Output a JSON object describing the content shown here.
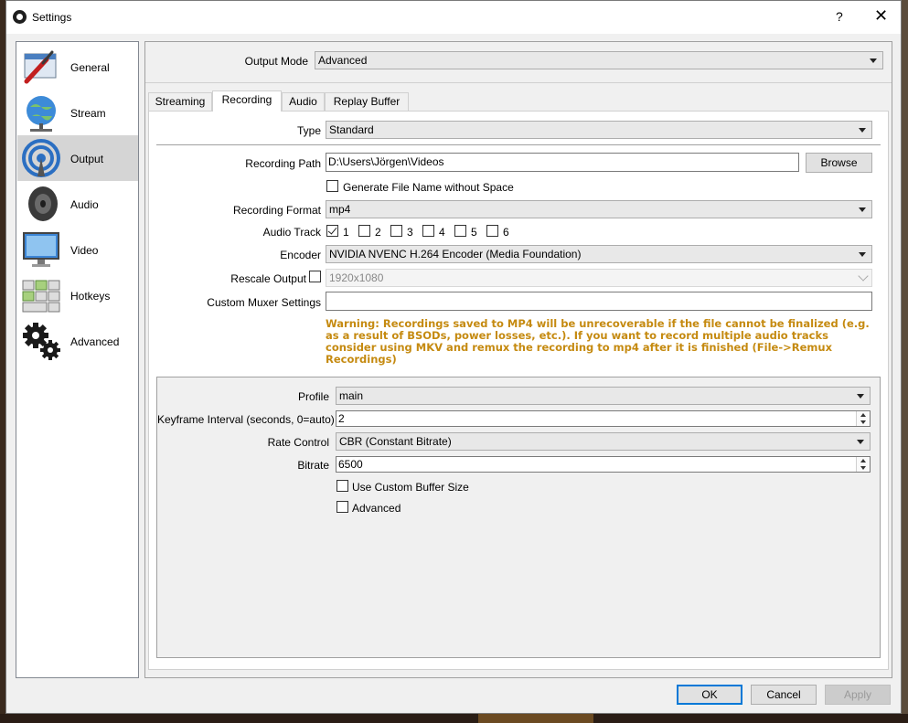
{
  "window": {
    "title": "Settings",
    "help": "?",
    "close": "✕"
  },
  "sidebar": {
    "items": [
      {
        "label": "General",
        "icon": "general-icon"
      },
      {
        "label": "Stream",
        "icon": "stream-icon"
      },
      {
        "label": "Output",
        "icon": "output-icon",
        "selected": true
      },
      {
        "label": "Audio",
        "icon": "audio-icon"
      },
      {
        "label": "Video",
        "icon": "video-icon"
      },
      {
        "label": "Hotkeys",
        "icon": "hotkeys-icon"
      },
      {
        "label": "Advanced",
        "icon": "advanced-icon"
      }
    ]
  },
  "output": {
    "mode_label": "Output Mode",
    "mode_value": "Advanced",
    "tabs": [
      "Streaming",
      "Recording",
      "Audio",
      "Replay Buffer"
    ],
    "active_tab": "Recording",
    "recording": {
      "type_label": "Type",
      "type_value": "Standard",
      "path_label": "Recording Path",
      "path_value": "D:\\Users\\Jörgen\\Videos",
      "browse": "Browse",
      "no_space_label": "Generate File Name without Space",
      "format_label": "Recording Format",
      "format_value": "mp4",
      "audio_track_label": "Audio Track",
      "tracks": [
        "1",
        "2",
        "3",
        "4",
        "5",
        "6"
      ],
      "encoder_label": "Encoder",
      "encoder_value": "NVIDIA NVENC H.264 Encoder (Media Foundation)",
      "rescale_label": "Rescale Output",
      "rescale_value": "1920x1080",
      "muxer_label": "Custom Muxer Settings",
      "muxer_value": "",
      "warning": "Warning: Recordings saved to MP4 will be unrecoverable if the file cannot be finalized (e.g. as a result of BSODs, power losses, etc.). If you want to record multiple audio tracks consider using MKV and remux the recording to mp4 after it is finished (File->Remux Recordings)"
    },
    "encoder_settings": {
      "profile_label": "Profile",
      "profile_value": "main",
      "keyframe_label": "Keyframe Interval (seconds, 0=auto)",
      "keyframe_value": "2",
      "rate_label": "Rate Control",
      "rate_value": "CBR (Constant Bitrate)",
      "bitrate_label": "Bitrate",
      "bitrate_value": "6500",
      "custom_buffer_label": "Use Custom Buffer Size",
      "advanced_label": "Advanced"
    }
  },
  "footer": {
    "ok": "OK",
    "cancel": "Cancel",
    "apply": "Apply"
  },
  "colors": {
    "warning": "#c58a10",
    "selected_bg": "#d5d5d5",
    "accent": "#0078d7"
  }
}
